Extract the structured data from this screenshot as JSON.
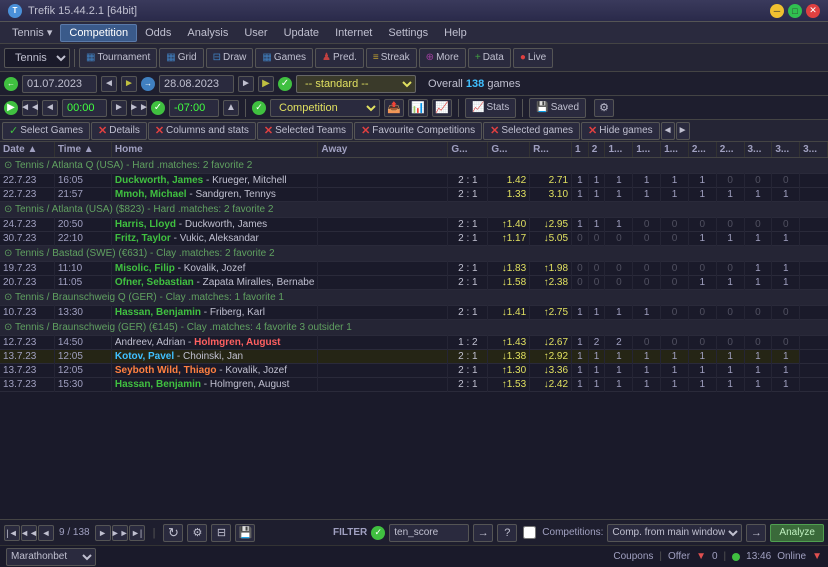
{
  "titlebar": {
    "title": "Trefik 15.44.2.1 [64bit]",
    "icon_label": "T"
  },
  "menu": {
    "items": [
      "Tennis",
      "Competition",
      "Odds",
      "Analysis",
      "User",
      "Update",
      "Internet",
      "Settings",
      "Help"
    ]
  },
  "toolbar": {
    "sport": "Tennis",
    "buttons": [
      "Tournament",
      "Grid",
      "Draw",
      "Games",
      "Pred.",
      "Streak",
      "More",
      "Data",
      "Live"
    ]
  },
  "datebar": {
    "prev_date": "01.07.2023",
    "next_date": "28.08.2023",
    "standard": "-- standard --",
    "overall_label": "Overall",
    "games_count": "138",
    "games_label": "games"
  },
  "timebar": {
    "time_val": "00:00",
    "time_offset": "-07:00",
    "competition_label": "Competition",
    "stats_label": "Stats",
    "saved_label": "Saved"
  },
  "actionbar": {
    "select_games": "Select Games",
    "details": "Details",
    "columns": "Columns and stats",
    "selected_teams": "Selected Teams",
    "fav_competitions": "Favourite Competitions",
    "selected_games": "Selected games",
    "hide_games": "Hide games"
  },
  "table": {
    "headers": [
      "Date",
      "Time",
      "Home",
      "Away",
      "G...",
      "G...",
      "R...",
      "1",
      "2",
      "1...",
      "1...",
      "1...",
      "2...",
      "2...",
      "3...",
      "3...",
      "3..."
    ],
    "sections": [
      {
        "type": "section",
        "label": "Tennis / Atlanta Q (USA)  - Hard .matches: 2    favorite 2"
      },
      {
        "type": "match",
        "date": "22.7.23",
        "time": "16:05",
        "home": "Duckworth, James",
        "away": "Krueger, Mitchell",
        "score": "2 : 1",
        "o1": "1.42",
        "o2": "2.71",
        "nums": [
          1,
          1,
          1,
          1,
          1,
          1,
          0,
          0,
          0
        ],
        "home_style": "home-win",
        "away_style": "normal-match"
      },
      {
        "type": "match",
        "date": "22.7.23",
        "time": "21:57",
        "home": "Mmoh, Michael",
        "away": "Sandgren, Tennys",
        "score": "2 : 1",
        "o1": "1.33",
        "o2": "3.10",
        "nums": [
          1,
          1,
          1,
          1,
          1,
          1,
          1,
          1,
          1
        ],
        "home_style": "home-win",
        "away_style": "normal-match"
      },
      {
        "type": "section",
        "label": "Tennis / Atlanta (USA) ($823) - Hard .matches: 2    favorite 2"
      },
      {
        "type": "match",
        "date": "24.7.23",
        "time": "20:50",
        "home": "Harris, Lloyd",
        "away": "Duckworth, James",
        "score": "2 : 1",
        "o1": "↑1.40",
        "o2": "↓2.95",
        "nums": [
          1,
          1,
          1,
          0,
          0,
          0,
          0,
          0,
          0
        ],
        "home_style": "home-win",
        "away_style": "normal-match"
      },
      {
        "type": "match",
        "date": "30.7.23",
        "time": "22:10",
        "home": "Fritz, Taylor",
        "away": "Vukic, Aleksandar",
        "score": "2 : 1",
        "o1": "↑1.17",
        "o2": "↓5.05",
        "nums": [
          0,
          0,
          0,
          0,
          0,
          1,
          1,
          1,
          1
        ],
        "home_style": "home-win",
        "away_style": "normal-match"
      },
      {
        "type": "section",
        "label": "Tennis / Bastad (SWE) (€631) - Clay .matches: 2    favorite 2"
      },
      {
        "type": "match",
        "date": "19.7.23",
        "time": "11:10",
        "home": "Misolic, Filip",
        "away": "Kovalik, Jozef",
        "score": "2 : 1",
        "o1": "↓1.83",
        "o2": "↑1.98",
        "nums": [
          0,
          0,
          0,
          0,
          0,
          0,
          0,
          1,
          1
        ],
        "home_style": "home-win",
        "away_style": "normal-match"
      },
      {
        "type": "match",
        "date": "20.7.23",
        "time": "11:05",
        "home": "Ofner, Sebastian",
        "away": "Zapata Miralles, Bernabe",
        "score": "2 : 1",
        "o1": "↓1.58",
        "o2": "↑2.38",
        "nums": [
          0,
          0,
          0,
          0,
          0,
          1,
          1,
          1,
          1
        ],
        "home_style": "home-win",
        "away_style": "normal-match"
      },
      {
        "type": "section",
        "label": "Tennis / Braunschweig Q (GER) - Clay .matches: 1    favorite 1"
      },
      {
        "type": "match",
        "date": "10.7.23",
        "time": "13:30",
        "home": "Hassan, Benjamin",
        "away": "Friberg, Karl",
        "score": "2 : 1",
        "o1": "↓1.41",
        "o2": "↑2.75",
        "nums": [
          1,
          1,
          1,
          1,
          0,
          0,
          0,
          0,
          0
        ],
        "home_style": "home-win",
        "away_style": "normal-match"
      },
      {
        "type": "section",
        "label": "Tennis / Braunschweig (GER) (€145) - Clay .matches: 4    favorite 3  outsider 1"
      },
      {
        "type": "match",
        "date": "12.7.23",
        "time": "14:50",
        "home": "Andreev, Adrian",
        "away": "Holmgren, August",
        "score": "1 : 2",
        "o1": "↑1.43",
        "o2": "↓2.67",
        "nums": [
          1,
          2,
          2,
          0,
          0,
          0,
          0,
          0,
          0
        ],
        "home_style": "normal-match",
        "away_style": "away-win"
      },
      {
        "type": "match",
        "date": "13.7.23",
        "time": "12:05",
        "home": "Kotov, Pavel",
        "away": "Choinski, Jan",
        "score": "2 : 1",
        "o1": "↓1.38",
        "o2": "↑2.92",
        "nums": [
          1,
          1,
          1,
          1,
          1,
          1,
          1,
          1,
          1
        ],
        "home_style": "team-highlight",
        "away_style": "normal-match",
        "highlight": true
      },
      {
        "type": "match",
        "date": "13.7.23",
        "time": "12:05",
        "home": "Seyboth Wild, Thiago",
        "away": "Kovalik, Jozef",
        "score": "2 : 1",
        "o1": "↑1.30",
        "o2": "↓3.36",
        "nums": [
          1,
          1,
          1,
          1,
          1,
          1,
          1,
          1,
          1
        ],
        "home_style": "team-highlight-red",
        "away_style": "normal-match"
      },
      {
        "type": "match",
        "date": "13.7.23",
        "time": "15:30",
        "home": "Hassan, Benjamin",
        "away": "Holmgren, August",
        "score": "2 : 1",
        "o1": "↑1.53",
        "o2": "↓2.42",
        "nums": [
          1,
          1,
          1,
          1,
          1,
          1,
          1,
          1,
          1
        ],
        "home_style": "home-win",
        "away_style": "normal-match"
      }
    ]
  },
  "bottombar": {
    "page_nav": "9 / 138",
    "filter_label": "FILTER",
    "filter_value": "ten_score",
    "competitions_label": "Competitions:",
    "comp_value": "Comp. from main window",
    "analyze_label": "Analyze"
  },
  "statusbar": {
    "broker": "Marathonbet",
    "coupons_label": "Coupons",
    "offer_label": "Offer",
    "offer_count": "0",
    "time": "13:46",
    "online_label": "Online"
  }
}
